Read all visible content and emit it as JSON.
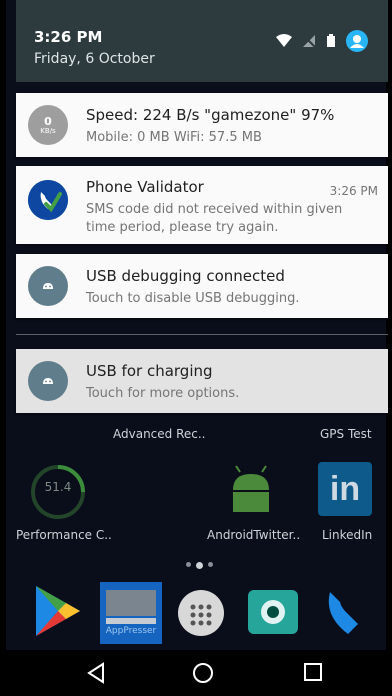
{
  "shade": {
    "time": "3:26 PM",
    "date": "Friday, 6 October"
  },
  "notifications": [
    {
      "title": "Speed: 224 B/s  \"gamezone\" 97%",
      "subtitle": "Mobile: 0 MB  WiFi: 57.5 MB",
      "icon_text_top": "0",
      "icon_text_bottom": "KB/s"
    },
    {
      "title": "Phone Validator",
      "time": "3:26 PM",
      "subtitle_line1": "SMS code did not received within given",
      "subtitle_line2": "time period, please try again."
    },
    {
      "title": "USB debugging connected",
      "subtitle": "Touch to disable USB debugging."
    },
    {
      "title": "USB for charging",
      "subtitle": "Touch for more options."
    }
  ],
  "home": {
    "labels": {
      "advanced": "Advanced Rec..",
      "gps": "GPS Test",
      "performance": "Performance C..",
      "androidtwitter": "AndroidTwitter..",
      "linkedin": "LinkedIn",
      "apppresser": "AppPresser"
    },
    "gauge_value": "51.4",
    "linkedin_logo": "in"
  },
  "colors": {
    "accent": "#29b6f6",
    "card_bg": "#fafafa",
    "header_bg": "#2d3a3e"
  }
}
